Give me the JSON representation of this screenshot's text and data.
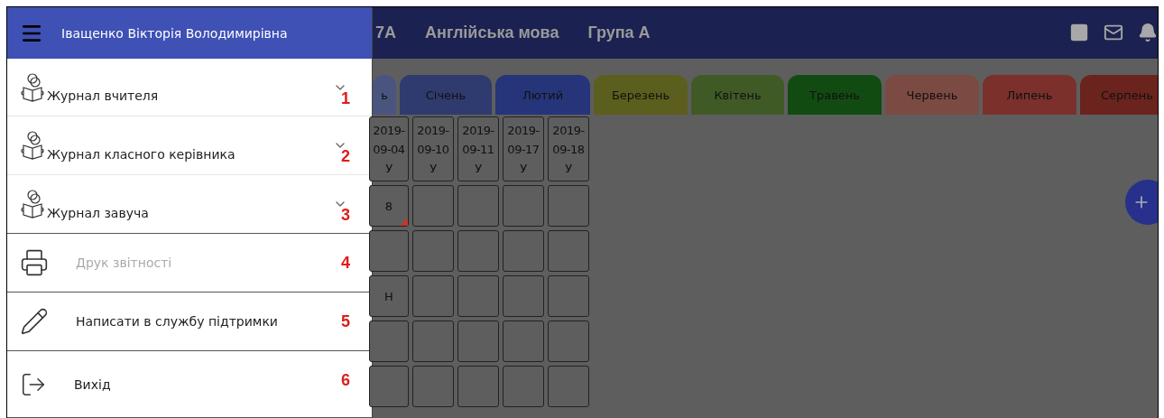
{
  "drawer": {
    "user_name": "Іващенко Вікторія Володимирівна",
    "items": [
      {
        "kind": "expandable",
        "label": "Журнал вчителя",
        "disabled": false,
        "callout": "1"
      },
      {
        "kind": "expandable",
        "label": "Журнал класного керівника",
        "disabled": false,
        "callout": "2"
      },
      {
        "kind": "expandable",
        "label": "Журнал завуча",
        "disabled": false,
        "callout": "3"
      },
      {
        "kind": "print",
        "label": "Друк звітності",
        "disabled": true,
        "callout": "4"
      },
      {
        "kind": "support",
        "label": "Написати в службу підтримки",
        "disabled": false,
        "callout": "5"
      },
      {
        "kind": "exit",
        "label": "Вихід",
        "disabled": false,
        "callout": "6"
      }
    ]
  },
  "header": {
    "class": "7А",
    "subject": "Англійська мова",
    "group": "Група А"
  },
  "month_tabs": [
    {
      "label": "ь",
      "color": "#4a557f"
    },
    {
      "label": "Січень",
      "color": "#2f3b6f"
    },
    {
      "label": "Лютий",
      "color": "#26347a"
    },
    {
      "label": "Березень",
      "color": "#5c5e1d"
    },
    {
      "label": "Квітень",
      "color": "#405a26"
    },
    {
      "label": "Травень",
      "color": "#124b12"
    },
    {
      "label": "Червень",
      "color": "#7b4a42"
    },
    {
      "label": "Липень",
      "color": "#7b302b"
    },
    {
      "label": "Серпень",
      "color": "#6b231d"
    }
  ],
  "journal": {
    "columns": [
      {
        "date": "2019-09-04",
        "type": "У"
      },
      {
        "date": "2019-09-10",
        "type": "У"
      },
      {
        "date": "2019-09-11",
        "type": "У"
      },
      {
        "date": "2019-09-17",
        "type": "У"
      },
      {
        "date": "2019-09-18",
        "type": "У"
      }
    ],
    "rows": [
      [
        {
          "value": "8",
          "flagged": true
        },
        {
          "flagged": false
        },
        {
          "flagged": false
        },
        {
          "flagged": false
        },
        {
          "flagged": false
        }
      ],
      [
        {
          "flagged": false
        },
        {
          "flagged": false
        },
        {
          "flagged": false
        },
        {
          "flagged": false
        },
        {
          "flagged": false
        }
      ],
      [
        {
          "value": "Н",
          "flagged": false
        },
        {
          "flagged": false
        },
        {
          "flagged": false
        },
        {
          "flagged": false
        },
        {
          "flagged": false
        }
      ],
      [
        {
          "flagged": false
        },
        {
          "flagged": false
        },
        {
          "flagged": false
        },
        {
          "flagged": false
        },
        {
          "flagged": false
        }
      ],
      [
        {
          "flagged": false
        },
        {
          "flagged": false
        },
        {
          "flagged": false
        },
        {
          "flagged": false
        },
        {
          "flagged": false
        }
      ]
    ]
  }
}
